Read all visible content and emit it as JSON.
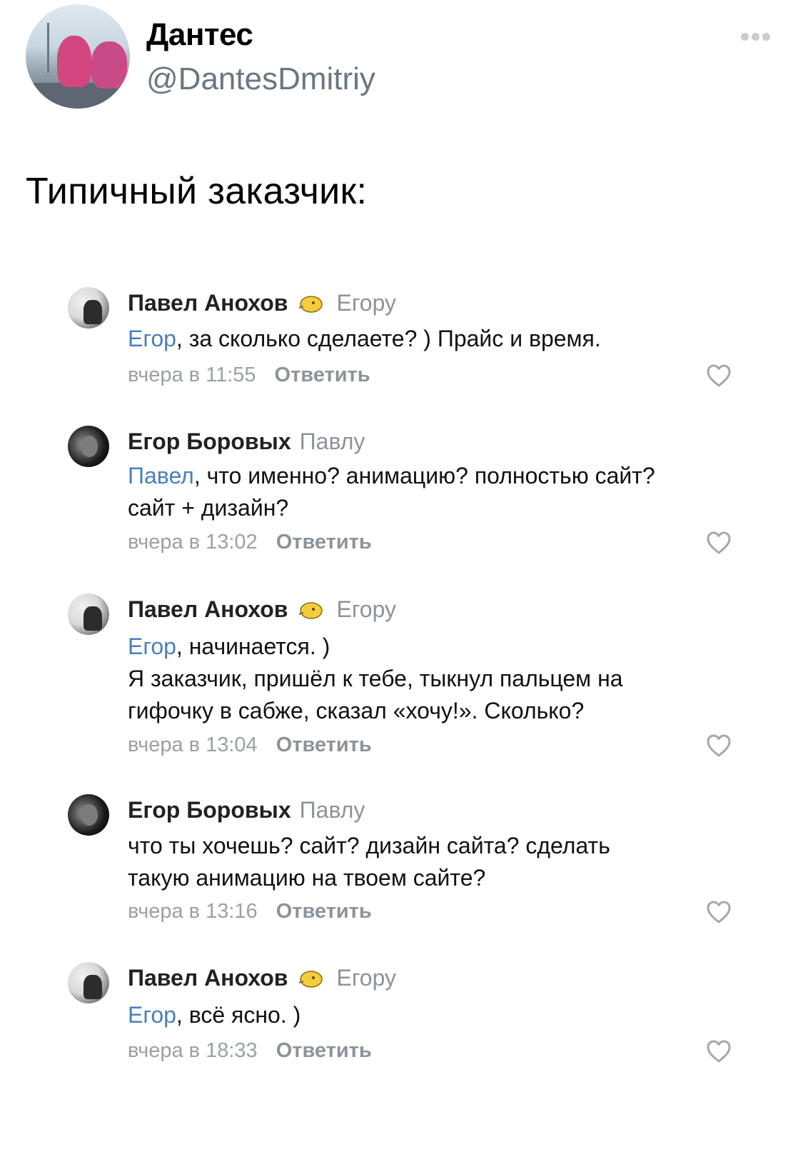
{
  "tweet": {
    "author_name": "Дантес",
    "author_handle": "@DantesDmitriy",
    "text": "Типичный заказчик:"
  },
  "comments": [
    {
      "author": "Павел Анохов",
      "has_badge": true,
      "reply_to": "Егору",
      "mention": "Егор",
      "body_lines": [
        ", за сколько сделаете? ) Прайс и время."
      ],
      "time": "вчера в 11:55",
      "reply_label": "Ответить"
    },
    {
      "author": "Егор Боровых",
      "has_badge": false,
      "reply_to": "Павлу",
      "mention": "Павел",
      "body_lines": [
        ", что именно? анимацию? полностью сайт?",
        "сайт + дизайн?"
      ],
      "time": "вчера в 13:02",
      "reply_label": "Ответить"
    },
    {
      "author": "Павел Анохов",
      "has_badge": true,
      "reply_to": "Егору",
      "mention": "Егор",
      "body_lines": [
        ", начинается. )",
        "Я заказчик, пришёл к тебе, тыкнул пальцем на",
        "гифочку в сабже, сказал «хочу!». Сколько?"
      ],
      "time": "вчера в 13:04",
      "reply_label": "Ответить"
    },
    {
      "author": "Егор Боровых",
      "has_badge": false,
      "reply_to": "Павлу",
      "mention": "",
      "body_lines": [
        "что ты хочешь? сайт? дизайн сайта? сделать",
        "такую анимацию на твоем сайте?"
      ],
      "time": "вчера в 13:16",
      "reply_label": "Ответить"
    },
    {
      "author": "Павел Анохов",
      "has_badge": true,
      "reply_to": "Егору",
      "mention": "Егор",
      "body_lines": [
        ", всё ясно. )"
      ],
      "time": "вчера в 18:33",
      "reply_label": "Ответить"
    }
  ],
  "icons": {
    "more": "more-horizontal-icon",
    "like": "heart-outline-icon",
    "badge": "lemon-badge-icon"
  },
  "colors": {
    "mention": "#4a7fbd",
    "meta": "#9aa0a6",
    "handle": "#6b7680"
  }
}
